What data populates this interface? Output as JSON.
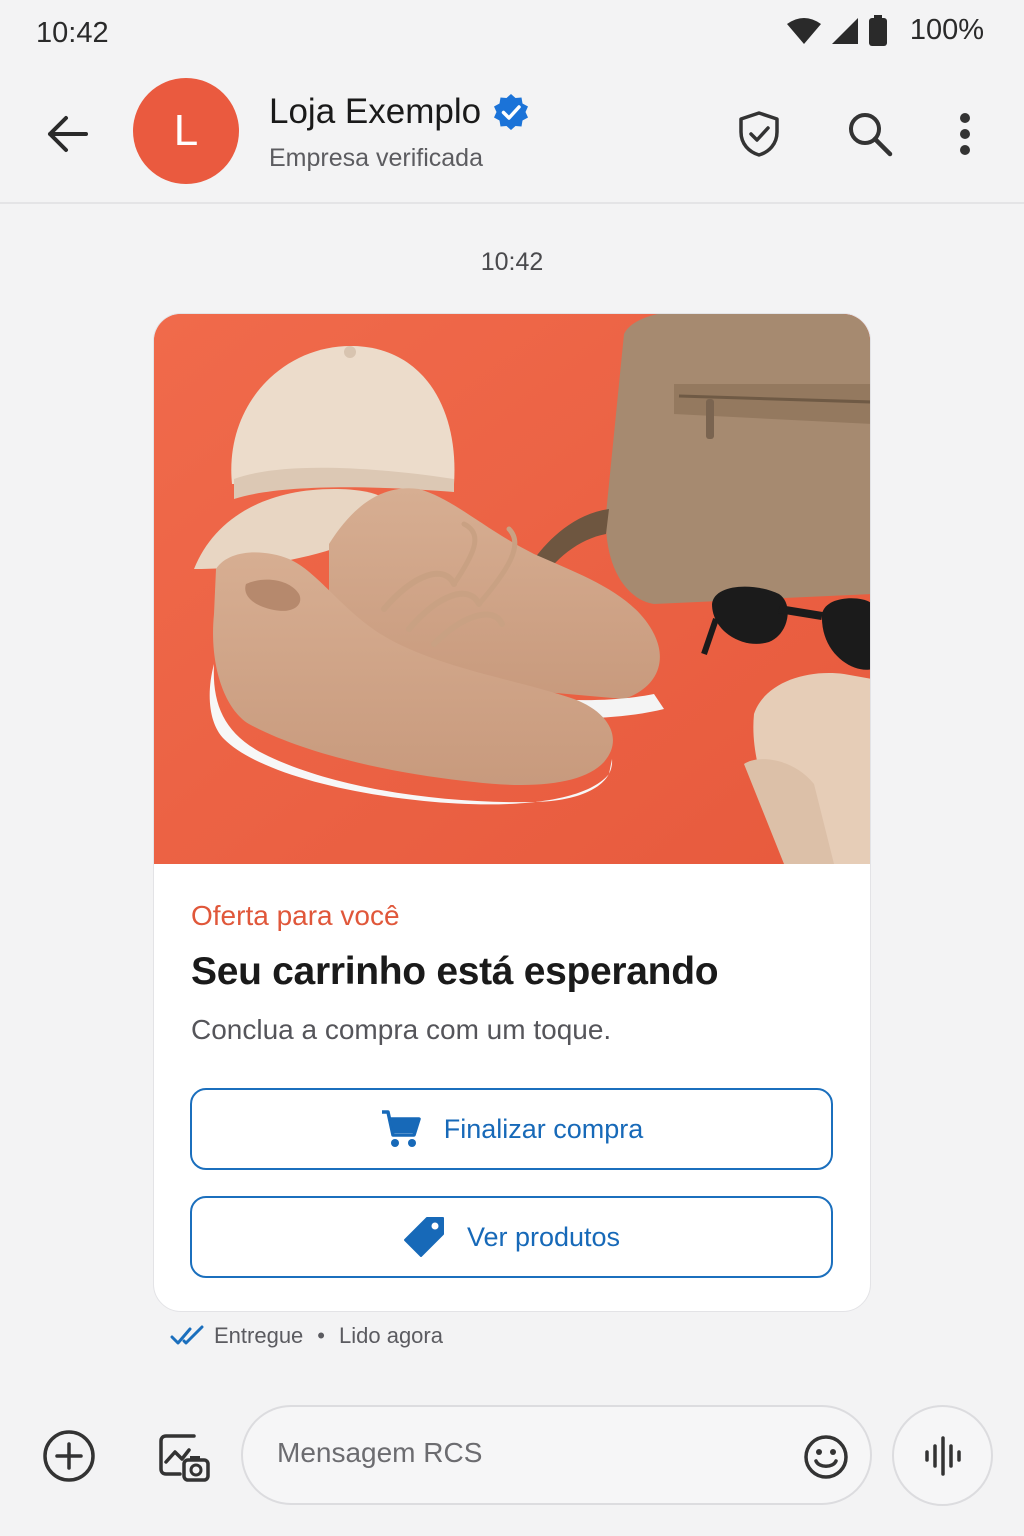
{
  "status_bar": {
    "time": "10:42",
    "battery": "100%"
  },
  "header": {
    "avatar_letter": "L",
    "name": "Loja Exemplo",
    "subtitle": "Empresa verificada"
  },
  "conversation": {
    "timestamp": "10:42"
  },
  "rich_card": {
    "media_description_icon": "product-photo",
    "label": "Oferta para você",
    "title": "Seu carrinho está esperando",
    "description": "Conclua a compra com um toque.",
    "suggestions": [
      {
        "label": "Finalizar compra",
        "icon": "cart-icon"
      },
      {
        "label": "Ver produtos",
        "icon": "tag-icon"
      }
    ]
  },
  "receipt": {
    "delivered": "Entregue",
    "separator": "•",
    "read": "Lido agora"
  },
  "composer": {
    "placeholder": "Mensagem RCS"
  },
  "colors": {
    "accent": "#1b6fbd",
    "brand": "#ea5a3f",
    "card_background": "#ef6547"
  }
}
